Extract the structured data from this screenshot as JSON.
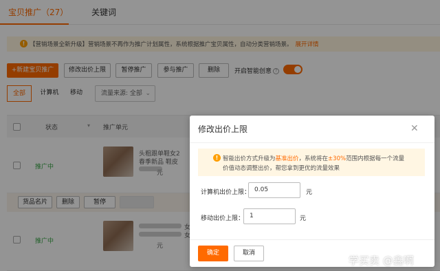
{
  "tabs": [
    {
      "label": "宝贝推广（27）",
      "active": true
    },
    {
      "label": "关键词",
      "active": false
    }
  ],
  "notice": {
    "text": "【营销场景全新升级】营销场景不再作为推广计划属性，系统根据推广宝贝属性，自动分类营销场景。",
    "link": "展开详情"
  },
  "toolbar": {
    "new_button": "+新建宝贝推广",
    "edit_bid_button": "修改出价上限",
    "pause_button": "暂停推广",
    "join_button": "参与推广",
    "delete_button": "删除",
    "smart_creative_label": "开启智能创意",
    "smart_creative_on": true
  },
  "filters": {
    "segments": [
      "全部",
      "计算机",
      "移动"
    ],
    "active_segment": "全部",
    "traffic_source": "流量来源: 全部"
  },
  "table": {
    "headers": {
      "status": "状态",
      "unit": "推广单元"
    },
    "rows": [
      {
        "status": "推广中",
        "title_line1": "头粗跟单鞋女2",
        "title_line2": "春季新品 鞋皮",
        "extra": "元"
      },
      {
        "status": "推广中",
        "title_line1": "女新",
        "title_line2": "女鞋",
        "extra": "元"
      }
    ]
  },
  "row_actions": {
    "goods_card": "货品名片",
    "delete": "删除",
    "pause": "暂停"
  },
  "modal": {
    "title": "修改出价上限",
    "close_icon": "close-icon",
    "tip": {
      "line1_pre": "智能出价方式升级为",
      "line1_hl1": "基准出价",
      "line1_mid": "，系统将在",
      "line1_hl2": "±30%",
      "line1_post": "范围内根据每一个流量",
      "line2": "价值动态调整出价，帮您拿到更优的流量效果"
    },
    "pc_label": "计算机出价上限：",
    "pc_value": "0.05",
    "pc_unit": "元",
    "mobile_label": "移动出价上限：",
    "mobile_value": "1",
    "mobile_unit": "元",
    "ok": "确定",
    "cancel": "取消"
  },
  "watermark": "学买卖 @鑫啊",
  "colors": {
    "accent": "#ff6a00",
    "success": "#3aa646",
    "tip_bg": "#fff6e3"
  }
}
